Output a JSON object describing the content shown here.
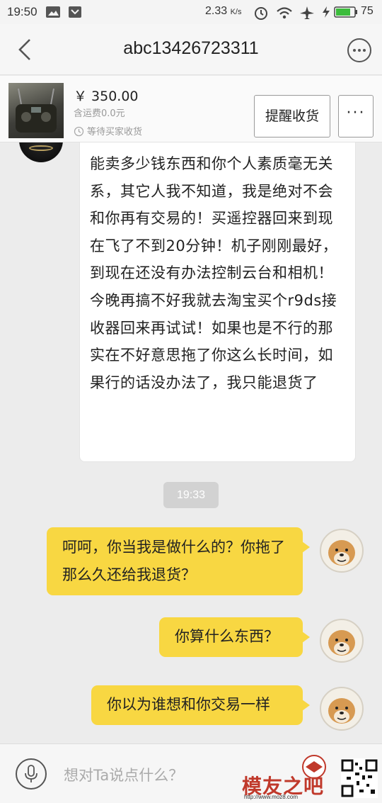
{
  "status_bar": {
    "time": "19:50",
    "speed": "2.33",
    "speed_unit": "K/s",
    "battery": "75"
  },
  "nav": {
    "title": "abc13426723311"
  },
  "product": {
    "price": "￥ 350.00",
    "shipping": "含运费0.0元",
    "status": "等待买家收货",
    "remind_label": "提醒收货",
    "more_label": "···"
  },
  "messages": {
    "peer_text": "能卖多少钱东西和你个人素质毫无关系，其它人我不知道，我是绝对不会和你再有交易的！买遥控器回来到现在飞了不到20分钟！机子刚刚最好，到现在还没有办法控制云台和相机！今晚再搞不好我就去淘宝买个r9ds接收器回来再试试！如果也是不行的那实在不好意思拖了你这么长时间，如果行的话没办法了，我只能退货了",
    "time_divider": "19:33",
    "me_1": "呵呵，你当我是做什么的？你拖了那么久还给我退货？",
    "me_2": "你算什么东西？",
    "me_3": "你以为谁想和你交易一样"
  },
  "input": {
    "placeholder": "想对Ta说点什么？"
  },
  "watermark": {
    "text": "模友之吧",
    "url": "http://www.moz8.com"
  },
  "colors": {
    "bubble_me": "#f8d742",
    "bubble_peer": "#ffffff",
    "background": "#ececec"
  }
}
